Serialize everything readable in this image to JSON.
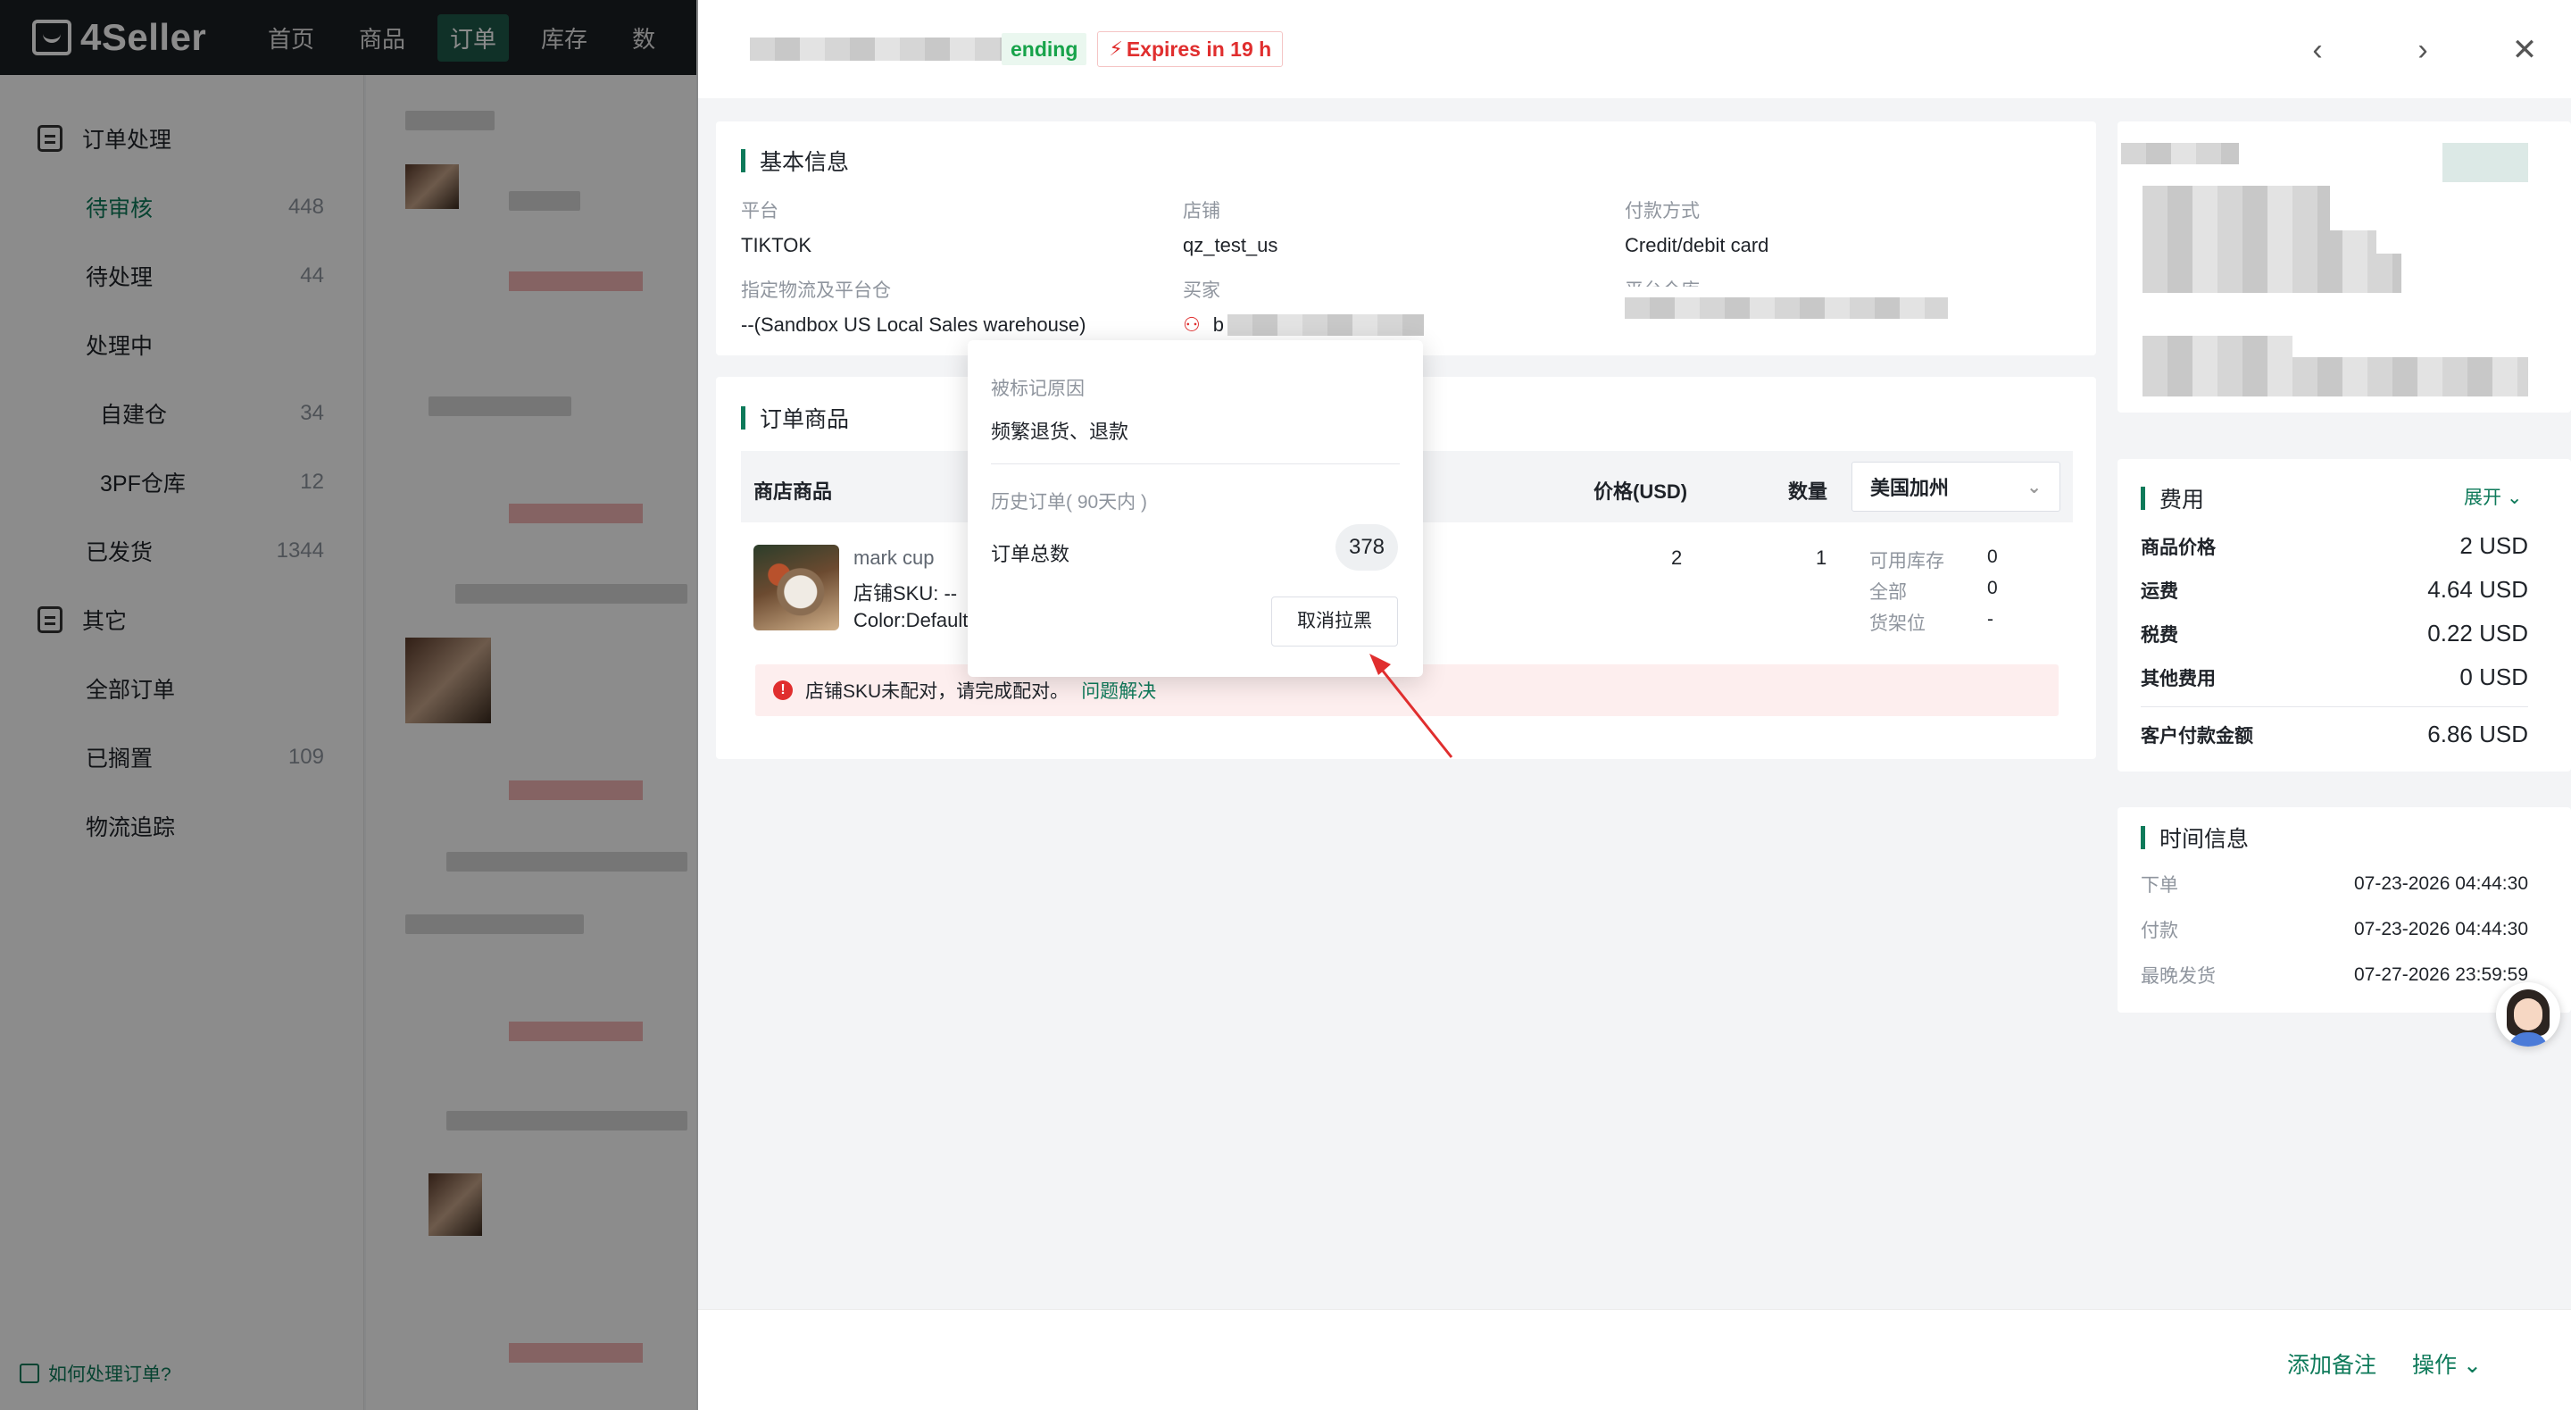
{
  "app": {
    "logo_text": "4Seller",
    "nav": [
      "首页",
      "商品",
      "订单",
      "库存",
      "数"
    ],
    "active_nav": "订单"
  },
  "sidebar": {
    "group_orders": "订单处理",
    "items": [
      {
        "label": "待审核",
        "count": "448"
      },
      {
        "label": "待处理",
        "count": "44"
      },
      {
        "label": "处理中",
        "count": ""
      },
      {
        "label": "自建仓",
        "count": "34"
      },
      {
        "label": "3PF仓库",
        "count": "12"
      },
      {
        "label": "已发货",
        "count": "1344"
      }
    ],
    "group_other": "其它",
    "other_items": [
      {
        "label": "全部订单",
        "count": ""
      },
      {
        "label": "已搁置",
        "count": "109"
      },
      {
        "label": "物流追踪",
        "count": ""
      }
    ],
    "help": "如何处理订单?"
  },
  "header": {
    "status": "ending",
    "expires": "Expires in 19 h",
    "prev_icon": "chevron-left-icon",
    "next_icon": "chevron-right-icon",
    "close_icon": "close-icon"
  },
  "basic_info": {
    "title": "基本信息",
    "platform_label": "平台",
    "platform": "TIKTOK",
    "store_label": "店铺",
    "store": "qz_test_us",
    "payment_label": "付款方式",
    "payment": "Credit/debit card",
    "logistics_label": "指定物流及平台仓",
    "logistics": "--(Sandbox US Local Sales warehouse)",
    "buyer_label": "买家",
    "buyer_initial": "b",
    "warehouse_label": "平台仓库"
  },
  "products": {
    "title": "订单商品",
    "col_product": "商店商品",
    "col_price": "价格(USD)",
    "col_qty": "数量",
    "region": "美国加州",
    "item": {
      "name": "mark cup",
      "sku": "店铺SKU: --",
      "variant": "Color:Default",
      "price": "2",
      "qty": "1",
      "stock_available_label": "可用库存",
      "stock_available": "0",
      "stock_all_label": "全部",
      "stock_all": "0",
      "shelf_label": "货架位",
      "shelf": "-"
    },
    "warning": "店铺SKU未配对，请完成配对。",
    "warning_link": "问题解决"
  },
  "popover": {
    "reason_label": "被标记原因",
    "reason": "频繁退货、退款",
    "history_label": "历史订单( 90天内 )",
    "total_label": "订单总数",
    "total": "378",
    "unblock_button": "取消拉黑"
  },
  "fees": {
    "title": "费用",
    "expand": "展开",
    "rows": [
      {
        "label": "商品价格",
        "value": "2 USD"
      },
      {
        "label": "运费",
        "value": "4.64 USD"
      },
      {
        "label": "税费",
        "value": "0.22 USD"
      },
      {
        "label": "其他费用",
        "value": "0 USD"
      }
    ],
    "total_label": "客户付款金额",
    "total": "6.86 USD"
  },
  "time_info": {
    "title": "时间信息",
    "rows": [
      {
        "label": "下单",
        "value": "07-23-2026 04:44:30"
      },
      {
        "label": "付款",
        "value": "07-23-2026 04:44:30"
      },
      {
        "label": "最晚发货",
        "value": "07-27-2026 23:59:59"
      }
    ]
  },
  "footer": {
    "add_note": "添加备注",
    "actions": "操作"
  },
  "colors": {
    "accent": "#0e7a5a",
    "danger": "#e02e2e",
    "success": "#17a34a"
  }
}
